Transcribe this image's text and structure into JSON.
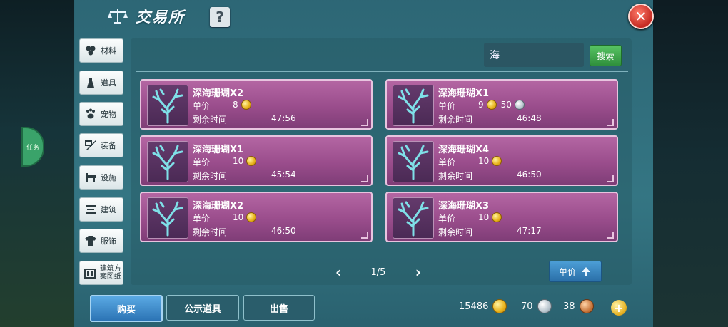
{
  "header": {
    "title": "交易所",
    "help_label": "?",
    "close_label": "✕"
  },
  "side_tab": {
    "label": "任务"
  },
  "categories": [
    {
      "label": "材料",
      "icon": "material-icon"
    },
    {
      "label": "道具",
      "icon": "potion-icon"
    },
    {
      "label": "宠物",
      "icon": "paw-icon"
    },
    {
      "label": "装备",
      "icon": "equipment-icon"
    },
    {
      "label": "设施",
      "icon": "facility-icon"
    },
    {
      "label": "建筑",
      "icon": "building-icon"
    },
    {
      "label": "服饰",
      "icon": "clothing-icon"
    },
    {
      "label": "建筑方案图纸",
      "icon": "blueprint-icon"
    }
  ],
  "search": {
    "value": "海",
    "button_label": "搜索"
  },
  "listings": [
    {
      "name": "深海珊瑚X2",
      "price_label": "单价",
      "gold": "8",
      "silver": "",
      "time_label": "剩余时间",
      "time": "47:56"
    },
    {
      "name": "深海珊瑚X1",
      "price_label": "单价",
      "gold": "9",
      "silver": "50",
      "time_label": "剩余时间",
      "time": "46:48"
    },
    {
      "name": "深海珊瑚X1",
      "price_label": "单价",
      "gold": "10",
      "silver": "",
      "time_label": "剩余时间",
      "time": "45:54"
    },
    {
      "name": "深海珊瑚X4",
      "price_label": "单价",
      "gold": "10",
      "silver": "",
      "time_label": "剩余时间",
      "time": "46:50"
    },
    {
      "name": "深海珊瑚X2",
      "price_label": "单价",
      "gold": "10",
      "silver": "",
      "time_label": "剩余时间",
      "time": "46:50"
    },
    {
      "name": "深海珊瑚X3",
      "price_label": "单价",
      "gold": "10",
      "silver": "",
      "time_label": "剩余时间",
      "time": "47:17"
    }
  ],
  "pagination": {
    "text": "1/5",
    "prev": "‹",
    "next": "›"
  },
  "sort": {
    "label": "单价"
  },
  "actions": {
    "buy": "购买",
    "show": "公示道具",
    "sell": "出售"
  },
  "currency": {
    "gold": "15486",
    "silver": "70",
    "bronze": "38",
    "add": "+"
  },
  "colors": {
    "card": "#9a4d8c",
    "buy": "#2c74b5",
    "search": "#2f8f3c"
  }
}
